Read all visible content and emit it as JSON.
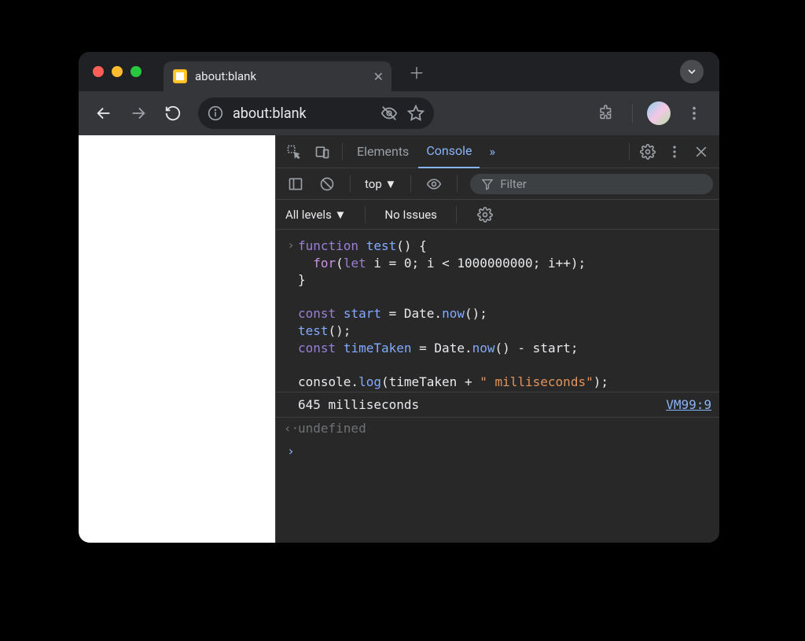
{
  "tab": {
    "title": "about:blank"
  },
  "toolbar": {
    "url": "about:blank"
  },
  "devtools": {
    "tabs": {
      "elements": "Elements",
      "console": "Console",
      "more": "»"
    },
    "console": {
      "context": "top",
      "filter_placeholder": "Filter",
      "levels": "All levels",
      "issues": "No Issues",
      "code": {
        "l1a": "function",
        "l1b": "test",
        "l1c": "() {",
        "l2a": "for",
        "l2b": "(",
        "l2c": "let",
        "l2d": " i ",
        "l2e": "=",
        "l2f": "0",
        "l2g": "; i ",
        "l2h": "<",
        "l2i": "1000000000",
        "l2j": "; i",
        "l2k": "++",
        "l2l": ");",
        "l3": "}",
        "l5a": "const",
        "l5b": "start",
        "l5c": " = ",
        "l5d": "Date",
        "l5e": ".",
        "l5f": "now",
        "l5g": "();",
        "l6a": "test",
        "l6b": "();",
        "l7a": "const",
        "l7b": "timeTaken",
        "l7c": " = ",
        "l7d": "Date",
        "l7e": ".",
        "l7f": "now",
        "l7g": "() ",
        "l7h": "-",
        "l7i": " start;",
        "l9a": "console.",
        "l9b": "log",
        "l9c": "(timeTaken ",
        "l9d": "+",
        "l9e": "\" milliseconds\"",
        "l9f": ");"
      },
      "output": "645 milliseconds",
      "source": "VM99:9",
      "return": "undefined"
    }
  }
}
